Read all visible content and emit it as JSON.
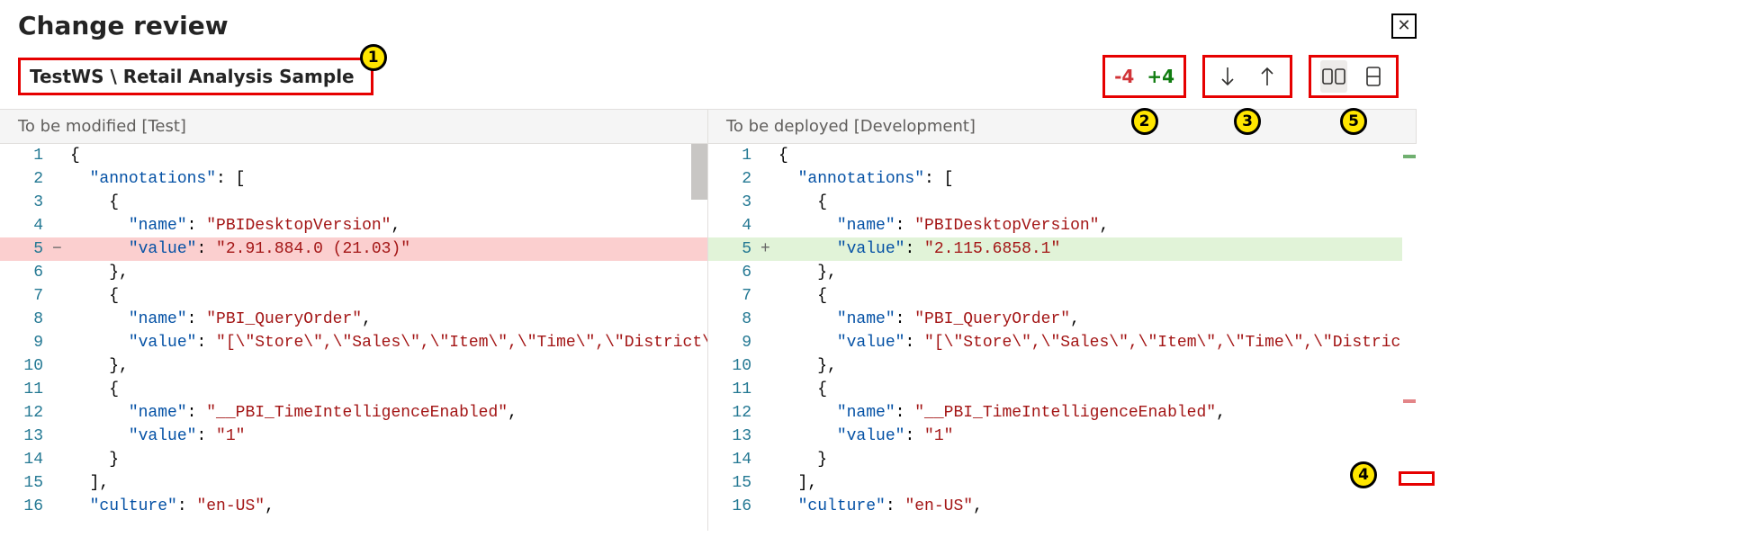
{
  "header": {
    "title": "Change review"
  },
  "breadcrumb": {
    "text": "TestWS \\ Retail Analysis Sample"
  },
  "callouts": {
    "c1": "1",
    "c2": "2",
    "c3": "3",
    "c4": "4",
    "c5": "5"
  },
  "counts": {
    "negative": "-4",
    "positive": "+4"
  },
  "panes": {
    "left_title": "To be modified [Test]",
    "right_title": "To be deployed [Development]"
  },
  "left_lines": [
    {
      "n": "1",
      "m": "",
      "cls": "",
      "tokens": [
        [
          "p",
          "{"
        ]
      ]
    },
    {
      "n": "2",
      "m": "",
      "cls": "",
      "tokens": [
        [
          "p",
          "  "
        ],
        [
          "k",
          "\"annotations\""
        ],
        [
          "p",
          ": ["
        ]
      ]
    },
    {
      "n": "3",
      "m": "",
      "cls": "",
      "tokens": [
        [
          "p",
          "    {"
        ]
      ]
    },
    {
      "n": "4",
      "m": "",
      "cls": "",
      "tokens": [
        [
          "p",
          "      "
        ],
        [
          "k",
          "\"name\""
        ],
        [
          "p",
          ": "
        ],
        [
          "s",
          "\"PBIDesktopVersion\""
        ],
        [
          "p",
          ","
        ]
      ]
    },
    {
      "n": "5",
      "m": "−",
      "cls": "removed",
      "tokens": [
        [
          "p",
          "      "
        ],
        [
          "k",
          "\"value\""
        ],
        [
          "p",
          ": "
        ],
        [
          "s",
          "\"2.91.884.0 (21.03)\""
        ]
      ]
    },
    {
      "n": "6",
      "m": "",
      "cls": "",
      "tokens": [
        [
          "p",
          "    },"
        ]
      ]
    },
    {
      "n": "7",
      "m": "",
      "cls": "",
      "tokens": [
        [
          "p",
          "    {"
        ]
      ]
    },
    {
      "n": "8",
      "m": "",
      "cls": "",
      "tokens": [
        [
          "p",
          "      "
        ],
        [
          "k",
          "\"name\""
        ],
        [
          "p",
          ": "
        ],
        [
          "s",
          "\"PBI_QueryOrder\""
        ],
        [
          "p",
          ","
        ]
      ]
    },
    {
      "n": "9",
      "m": "",
      "cls": "",
      "tokens": [
        [
          "p",
          "      "
        ],
        [
          "k",
          "\"value\""
        ],
        [
          "p",
          ": "
        ],
        [
          "s",
          "\"[\\\"Store\\\",\\\"Sales\\\",\\\"Item\\\",\\\"Time\\\",\\\"District\\\"]\""
        ]
      ]
    },
    {
      "n": "10",
      "m": "",
      "cls": "",
      "tokens": [
        [
          "p",
          "    },"
        ]
      ]
    },
    {
      "n": "11",
      "m": "",
      "cls": "",
      "tokens": [
        [
          "p",
          "    {"
        ]
      ]
    },
    {
      "n": "12",
      "m": "",
      "cls": "",
      "tokens": [
        [
          "p",
          "      "
        ],
        [
          "k",
          "\"name\""
        ],
        [
          "p",
          ": "
        ],
        [
          "s",
          "\"__PBI_TimeIntelligenceEnabled\""
        ],
        [
          "p",
          ","
        ]
      ]
    },
    {
      "n": "13",
      "m": "",
      "cls": "",
      "tokens": [
        [
          "p",
          "      "
        ],
        [
          "k",
          "\"value\""
        ],
        [
          "p",
          ": "
        ],
        [
          "s",
          "\"1\""
        ]
      ]
    },
    {
      "n": "14",
      "m": "",
      "cls": "",
      "tokens": [
        [
          "p",
          "    }"
        ]
      ]
    },
    {
      "n": "15",
      "m": "",
      "cls": "",
      "tokens": [
        [
          "p",
          "  ],"
        ]
      ]
    },
    {
      "n": "16",
      "m": "",
      "cls": "",
      "tokens": [
        [
          "p",
          "  "
        ],
        [
          "k",
          "\"culture\""
        ],
        [
          "p",
          ": "
        ],
        [
          "s",
          "\"en-US\""
        ],
        [
          "p",
          ","
        ]
      ]
    }
  ],
  "right_lines": [
    {
      "n": "1",
      "m": "",
      "cls": "",
      "tokens": [
        [
          "p",
          "{"
        ]
      ]
    },
    {
      "n": "2",
      "m": "",
      "cls": "",
      "tokens": [
        [
          "p",
          "  "
        ],
        [
          "k",
          "\"annotations\""
        ],
        [
          "p",
          ": ["
        ]
      ]
    },
    {
      "n": "3",
      "m": "",
      "cls": "",
      "tokens": [
        [
          "p",
          "    {"
        ]
      ]
    },
    {
      "n": "4",
      "m": "",
      "cls": "",
      "tokens": [
        [
          "p",
          "      "
        ],
        [
          "k",
          "\"name\""
        ],
        [
          "p",
          ": "
        ],
        [
          "s",
          "\"PBIDesktopVersion\""
        ],
        [
          "p",
          ","
        ]
      ]
    },
    {
      "n": "5",
      "m": "+",
      "cls": "added",
      "tokens": [
        [
          "p",
          "      "
        ],
        [
          "k",
          "\"value\""
        ],
        [
          "p",
          ": "
        ],
        [
          "s",
          "\"2.115.6858.1\""
        ]
      ]
    },
    {
      "n": "6",
      "m": "",
      "cls": "",
      "tokens": [
        [
          "p",
          "    },"
        ]
      ]
    },
    {
      "n": "7",
      "m": "",
      "cls": "",
      "tokens": [
        [
          "p",
          "    {"
        ]
      ]
    },
    {
      "n": "8",
      "m": "",
      "cls": "",
      "tokens": [
        [
          "p",
          "      "
        ],
        [
          "k",
          "\"name\""
        ],
        [
          "p",
          ": "
        ],
        [
          "s",
          "\"PBI_QueryOrder\""
        ],
        [
          "p",
          ","
        ]
      ]
    },
    {
      "n": "9",
      "m": "",
      "cls": "",
      "tokens": [
        [
          "p",
          "      "
        ],
        [
          "k",
          "\"value\""
        ],
        [
          "p",
          ": "
        ],
        [
          "s",
          "\"[\\\"Store\\\",\\\"Sales\\\",\\\"Item\\\",\\\"Time\\\",\\\"District\\\"]\""
        ]
      ]
    },
    {
      "n": "10",
      "m": "",
      "cls": "",
      "tokens": [
        [
          "p",
          "    },"
        ]
      ]
    },
    {
      "n": "11",
      "m": "",
      "cls": "",
      "tokens": [
        [
          "p",
          "    {"
        ]
      ]
    },
    {
      "n": "12",
      "m": "",
      "cls": "",
      "tokens": [
        [
          "p",
          "      "
        ],
        [
          "k",
          "\"name\""
        ],
        [
          "p",
          ": "
        ],
        [
          "s",
          "\"__PBI_TimeIntelligenceEnabled\""
        ],
        [
          "p",
          ","
        ]
      ]
    },
    {
      "n": "13",
      "m": "",
      "cls": "",
      "tokens": [
        [
          "p",
          "      "
        ],
        [
          "k",
          "\"value\""
        ],
        [
          "p",
          ": "
        ],
        [
          "s",
          "\"1\""
        ]
      ]
    },
    {
      "n": "14",
      "m": "",
      "cls": "",
      "tokens": [
        [
          "p",
          "    }"
        ]
      ]
    },
    {
      "n": "15",
      "m": "",
      "cls": "",
      "tokens": [
        [
          "p",
          "  ],"
        ]
      ]
    },
    {
      "n": "16",
      "m": "",
      "cls": "",
      "tokens": [
        [
          "p",
          "  "
        ],
        [
          "k",
          "\"culture\""
        ],
        [
          "p",
          ": "
        ],
        [
          "s",
          "\"en-US\""
        ],
        [
          "p",
          ","
        ]
      ]
    }
  ]
}
